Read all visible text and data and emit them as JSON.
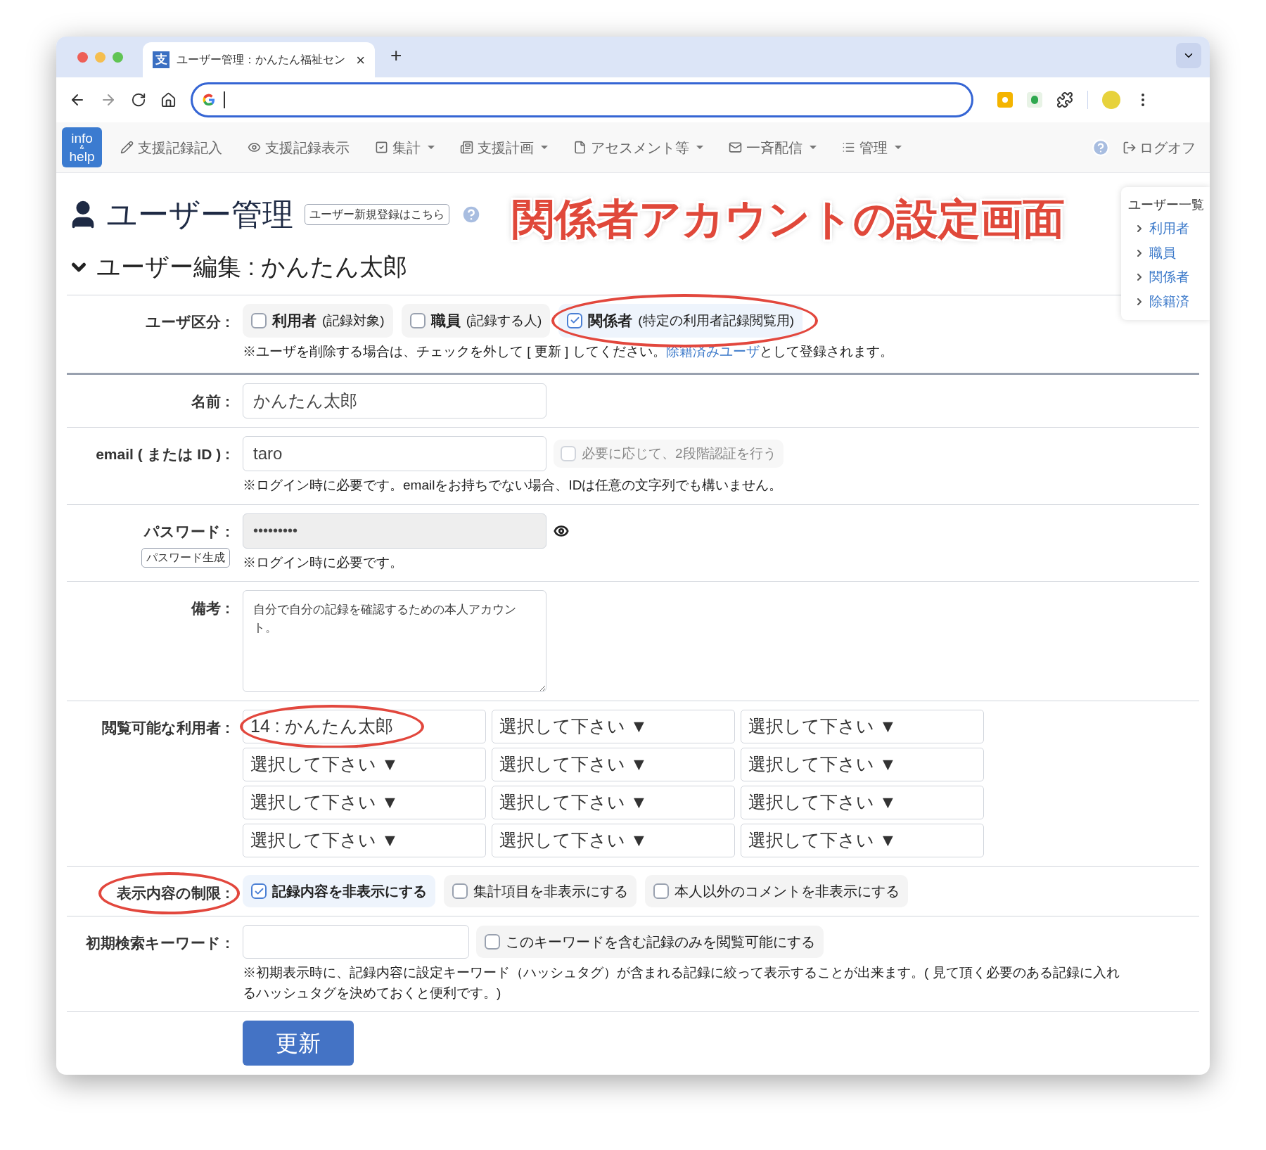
{
  "browser": {
    "tab": {
      "favicon": "支",
      "title": "ユーザー管理：かんたん福祉セン",
      "close": "×"
    },
    "new_tab": "+"
  },
  "nav": {
    "logo": [
      "info",
      "&",
      "help"
    ],
    "items": [
      {
        "label": "支援記録記入",
        "dropdown": false
      },
      {
        "label": "支援記録表示",
        "dropdown": false
      },
      {
        "label": "集計",
        "dropdown": true
      },
      {
        "label": "支援計画",
        "dropdown": true
      },
      {
        "label": "アセスメント等",
        "dropdown": true
      },
      {
        "label": "一斉配信",
        "dropdown": true
      },
      {
        "label": "管理",
        "dropdown": true
      }
    ],
    "logoff": "ログオフ"
  },
  "page": {
    "title": "ユーザー管理",
    "new_user_link": "ユーザー新規登録はこちら",
    "section": "ユーザー編集 : かんたん太郎",
    "section_expanded": true
  },
  "annotation": "関係者アカウントの設定画面",
  "sidebar": {
    "title": "ユーザー一覧",
    "items": [
      "利用者",
      "職員",
      "関係者",
      "除籍済"
    ]
  },
  "form": {
    "user_type": {
      "label": "ユーザ区分 :",
      "options": [
        {
          "label": "利用者",
          "note": "(記録対象)",
          "checked": false,
          "circled": false
        },
        {
          "label": "職員",
          "note": "(記録する人)",
          "checked": false,
          "circled": false
        },
        {
          "label": "関係者",
          "note": "(特定の利用者記録閲覧用)",
          "checked": true,
          "circled": true
        }
      ],
      "note_before": "※ユーザを削除する場合は、チェックを外して [ 更新 ] してください。",
      "note_link": "除籍済みユーザ",
      "note_after": "として登録されます。"
    },
    "name": {
      "label": "名前 :",
      "value": "かんたん太郎"
    },
    "email": {
      "label": "email ( または ID ) :",
      "value": "taro",
      "two_factor": {
        "label": "必要に応じて、2段階認証を行う",
        "checked": false
      },
      "note": "※ログイン時に必要です。emailをお持ちでない場合、IDは任意の文字列でも構いません。"
    },
    "password": {
      "label": "パスワード :",
      "generate": "パスワード生成",
      "value": "•••••••••",
      "note": "※ログイン時に必要です。"
    },
    "remarks": {
      "label": "備考 :",
      "value": "自分で自分の記録を確認するための本人アカウント。"
    },
    "viewable": {
      "label": "閲覧可能な利用者 :",
      "selects": [
        {
          "text": "14 : かんたん太郎",
          "circled": true
        },
        {
          "text": "選択して下さい ▼",
          "circled": false
        },
        {
          "text": "選択して下さい ▼",
          "circled": false
        },
        {
          "text": "選択して下さい ▼",
          "circled": false
        },
        {
          "text": "選択して下さい ▼",
          "circled": false
        },
        {
          "text": "選択して下さい ▼",
          "circled": false
        },
        {
          "text": "選択して下さい ▼",
          "circled": false
        },
        {
          "text": "選択して下さい ▼",
          "circled": false
        },
        {
          "text": "選択して下さい ▼",
          "circled": false
        },
        {
          "text": "選択して下さい ▼",
          "circled": false
        },
        {
          "text": "選択して下さい ▼",
          "circled": false
        },
        {
          "text": "選択して下さい ▼",
          "circled": false
        }
      ]
    },
    "restriction": {
      "label": "表示内容の制限 :",
      "label_circled": true,
      "options": [
        {
          "label": "記録内容を非表示にする",
          "checked": true
        },
        {
          "label": "集計項目を非表示にする",
          "checked": false
        },
        {
          "label": "本人以外のコメントを非表示にする",
          "checked": false
        }
      ]
    },
    "keyword": {
      "label": "初期検索キーワード :",
      "only": {
        "label": "このキーワードを含む記録のみを閲覧可能にする",
        "checked": false
      },
      "note": "※初期表示時に、記録内容に設定キーワード（ハッシュタグ）が含まれる記録に絞って表示することが出来ます。( 見て頂く必要のある記録に入れるハッシュタグを決めておくと便利です。)"
    },
    "submit": "更新"
  }
}
